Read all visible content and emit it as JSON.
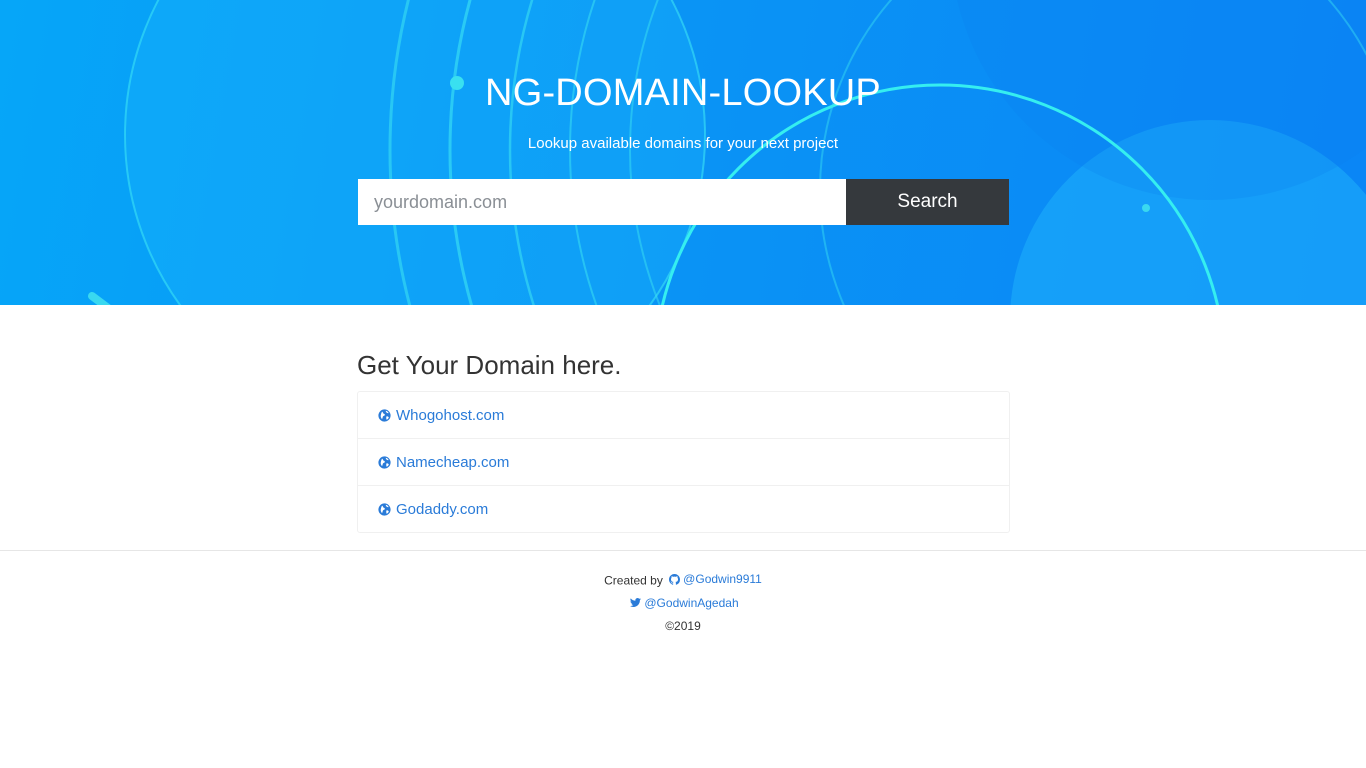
{
  "hero": {
    "title": "NG-DOMAIN-LOOKUP",
    "subtitle": "Lookup available domains for your next project",
    "background_color": "#0a95f5"
  },
  "search": {
    "placeholder": "yourdomain.com",
    "value": "",
    "button_label": "Search",
    "button_color": "#35393d"
  },
  "domains": {
    "heading": "Get Your Domain here.",
    "items": [
      {
        "label": "Whogohost.com",
        "icon": "globe-icon"
      },
      {
        "label": "Namecheap.com",
        "icon": "globe-icon"
      },
      {
        "label": "Godaddy.com",
        "icon": "globe-icon"
      }
    ],
    "link_color": "#2a7bd8"
  },
  "footer": {
    "created_by": "Created by",
    "github_handle": "@Godwin9911",
    "github_icon": "github-icon",
    "twitter_handle": "@GodwinAgedah",
    "twitter_icon": "twitter-icon",
    "copyright": "©2019"
  }
}
